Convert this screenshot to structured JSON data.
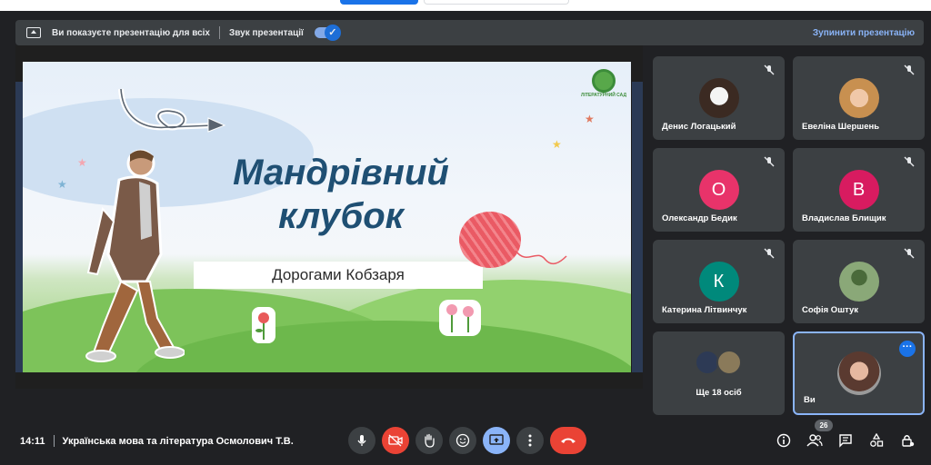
{
  "banner": {
    "presenting_text": "Ви показуєте презентацію для всіх",
    "sound_label": "Звук презентації",
    "stop_label": "Зупинити презентацію"
  },
  "slide": {
    "title_line1": "Мандрівний",
    "title_line2": "клубок",
    "subtitle": "Дорогами Кобзаря",
    "logo_text": "ЛІТЕРАТУРНИЙ САД"
  },
  "participants": [
    {
      "name": "Денис Логацький",
      "avatar_type": "photo",
      "muted": true
    },
    {
      "name": "Евеліна Шершень",
      "avatar_type": "photo",
      "muted": true
    },
    {
      "name": "Олександр Бедик",
      "initial": "О",
      "color": "#e8336a",
      "muted": true
    },
    {
      "name": "Владислав Блищик",
      "initial": "В",
      "color": "#d81b60",
      "muted": true
    },
    {
      "name": "Катерина Літвинчук",
      "initial": "К",
      "color": "#00897b",
      "muted": true
    },
    {
      "name": "Софія Оштук",
      "avatar_type": "photo",
      "muted": true
    }
  ],
  "others_tile": {
    "label": "Ще 18 осіб"
  },
  "self_tile": {
    "name": "Ви"
  },
  "bottom": {
    "time": "14:11",
    "meeting_title": "Українська мова та література Осмолович Т.В.",
    "participant_count": "26"
  },
  "colors": {
    "accent": "#8ab4f8",
    "danger": "#ea4335",
    "tile_bg": "#3c4043",
    "background": "#202124"
  },
  "icons": {
    "mic": "mic-icon",
    "camera_off": "camera-off-icon",
    "raise_hand": "raise-hand-icon",
    "emoji": "emoji-icon",
    "present": "present-screen-icon",
    "more": "more-vert-icon",
    "hangup": "hangup-icon",
    "info": "info-icon",
    "people": "people-icon",
    "chat": "chat-icon",
    "activities": "activities-icon",
    "host_controls": "host-controls-icon"
  }
}
